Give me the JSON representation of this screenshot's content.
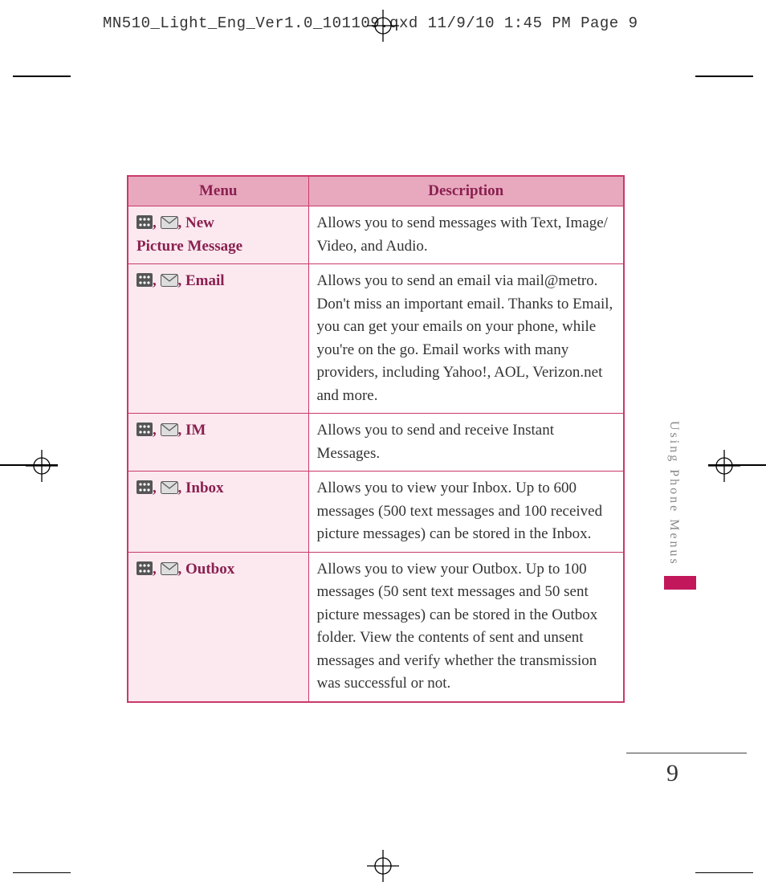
{
  "header": {
    "line": "MN510_Light_Eng_Ver1.0_101109.qxd  11/9/10  1:45 PM  Page 9"
  },
  "table": {
    "headers": {
      "menu": "Menu",
      "description": "Description"
    },
    "rows": [
      {
        "menu_label": "New",
        "menu_label_secondary": "Picture Message",
        "description": "Allows you to send messages with Text, Image/ Video, and Audio."
      },
      {
        "menu_label": "Email",
        "menu_label_secondary": "",
        "description": "Allows you to send an email via mail@metro. Don't miss an important email. Thanks to Email, you can get your emails on your phone, while you're on the go. Email works with many providers, including Yahoo!, AOL, Verizon.net and more."
      },
      {
        "menu_label": "IM",
        "menu_label_secondary": "",
        "description": "Allows you to send and receive Instant Messages."
      },
      {
        "menu_label": "Inbox",
        "menu_label_secondary": "",
        "description": "Allows you to view your Inbox. Up to 600 messages (500 text messages and 100 received picture messages) can be stored in the Inbox."
      },
      {
        "menu_label": "Outbox",
        "menu_label_secondary": "",
        "description": "Allows you to view your Outbox. Up to 100 messages (50 sent text messages and 50 sent picture messages) can be stored in the Outbox folder. View the contents of sent and unsent messages and verify whether the transmission was successful or not."
      }
    ]
  },
  "sideTab": "Using Phone Menus",
  "pageNumber": "9",
  "separators": {
    "comma": ", "
  }
}
